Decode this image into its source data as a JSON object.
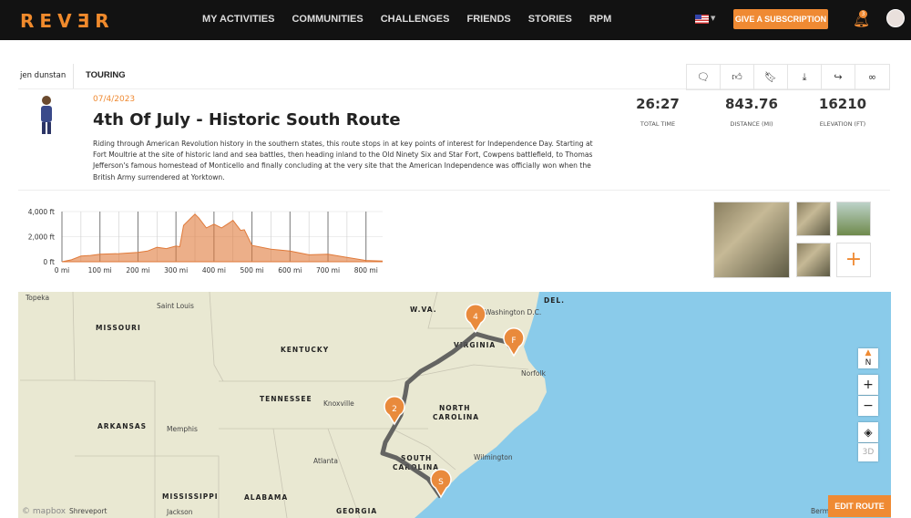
{
  "nav": {
    "logo": "REVƎR",
    "items": [
      "MY ACTIVITIES",
      "COMMUNITIES",
      "CHALLENGES",
      "FRIENDS",
      "STORIES",
      "RPM"
    ],
    "subscribe": "GIVE A SUBSCRIPTION",
    "notifications": "3",
    "accent": "#ef8a33"
  },
  "breadcrumb": {
    "user": "jen dunstan",
    "type": "TOURING"
  },
  "actions": [
    "comment-icon",
    "like-icon",
    "bookmark-icon",
    "download-icon",
    "share-icon",
    "link-icon"
  ],
  "activity": {
    "date": "07/4/2023",
    "title": "4th Of July - Historic South Route",
    "description": "Riding through American Revolution history in the southern states, this route stops in at key points of interest for Independence Day. Starting at Fort Moultrie at the site of historic land and sea battles, then heading inland to the Old Ninety Six and Star Fort, Cowpens battlefield, to Thomas Jefferson's famous homestead of Monticello and finally concluding at the very site that the American Independence was officially won when the British Army surrendered at Yorktown."
  },
  "stats": [
    {
      "value": "26:27",
      "label": "TOTAL TIME"
    },
    {
      "value": "843.76",
      "label": "DISTANCE (MI)"
    },
    {
      "value": "16210",
      "label": "ELEVATION (FT)"
    }
  ],
  "chart_data": {
    "type": "area",
    "xlabel": "",
    "ylabel": "",
    "xlim": [
      0,
      843.76
    ],
    "ylim": [
      0,
      4000
    ],
    "grid": true,
    "color": "#e07a3a",
    "x_ticks": [
      "0 mi",
      "100 mi",
      "200 mi",
      "300 mi",
      "400 mi",
      "500 mi",
      "600 mi",
      "700 mi",
      "800 mi"
    ],
    "y_ticks": [
      "0 ft",
      "2,000 ft",
      "4,000 ft"
    ],
    "x": [
      0,
      25,
      50,
      75,
      100,
      150,
      200,
      225,
      250,
      275,
      300,
      310,
      320,
      340,
      350,
      360,
      380,
      400,
      420,
      440,
      450,
      470,
      480,
      500,
      550,
      600,
      650,
      700,
      750,
      800,
      843
    ],
    "y": [
      0,
      150,
      450,
      500,
      600,
      650,
      750,
      850,
      1150,
      1050,
      1250,
      1200,
      2900,
      3500,
      3800,
      3500,
      2700,
      3000,
      2700,
      3100,
      3300,
      2500,
      2550,
      1300,
      1000,
      850,
      550,
      600,
      350,
      100,
      50
    ]
  },
  "photos": {
    "add": "+"
  },
  "map": {
    "labels": [
      "Topeka",
      "Saint Louis",
      "MISSOURI",
      "KENTUCKY",
      "W.VA.",
      "Washington D.C.",
      "DEL.",
      "VIRGINIA",
      "Norfolk",
      "TENNESSEE",
      "Knoxville",
      "NORTH",
      "CAROLINA",
      "ARKANSAS",
      "Memphis",
      "Atlanta",
      "SOUTH",
      "CAROLINA",
      "Wilmington",
      "MISSISSIPPI",
      "ALABAMA",
      "GEORGIA",
      "Shreveport",
      "Jackson",
      "Berm"
    ],
    "pins": [
      "S",
      "2",
      "4",
      "F"
    ],
    "compass": "N",
    "zoom_in": "+",
    "zoom_out": "−",
    "three_d": "3D",
    "edit_route": "EDIT ROUTE",
    "attribution": "© mapbox"
  }
}
